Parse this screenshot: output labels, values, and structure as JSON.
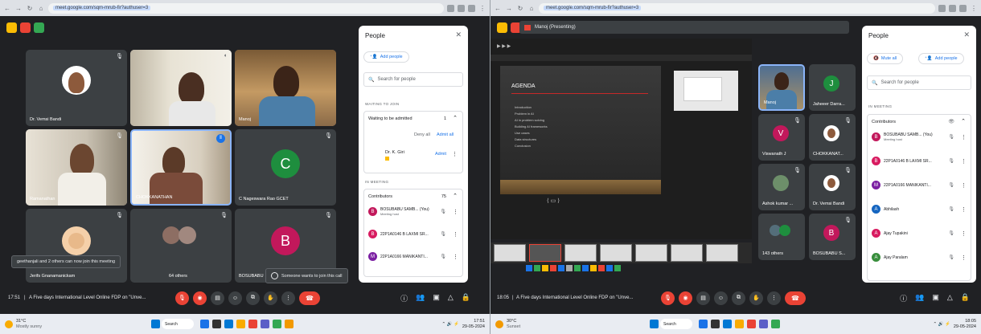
{
  "left": {
    "url": "meet.google.com/sqm-mrub-fir?authuser=3",
    "tiles": [
      {
        "name": "Dr. Vemsi Bandi"
      },
      {
        "name": ""
      },
      {
        "name": "Manoj"
      },
      {
        "name": "Ramanathan"
      },
      {
        "name": "CHOKKANATHAN"
      },
      {
        "name": "C Nageswara Rao GCET",
        "initial": "C"
      },
      {
        "name": "Jerifs Gnanamanickam"
      },
      {
        "name": "64 others"
      },
      {
        "name": "BOSUBABU",
        "initial": "B"
      }
    ],
    "toast_left": "geethanjali and 2 others can now join this meeting",
    "toast_right": "Someone wants to join this call",
    "people": {
      "title": "People",
      "add_people": "Add people",
      "search_placeholder": "Search for people",
      "waiting_header": "WAITING TO JOIN",
      "waiting_label": "Waiting to be admitted",
      "waiting_count": "1",
      "deny_all": "Deny all",
      "admit_all": "Admit all",
      "waiting_person": "Dr. K. Giri",
      "admit": "Admit",
      "in_meeting_header": "IN MEETING",
      "contributors": "Contributors",
      "contributors_count": "75",
      "rows": [
        {
          "initial": "B",
          "name": "BOSUBABU SAMB... (You)",
          "sub": "Meeting host",
          "color": "#c2185b"
        },
        {
          "initial": "B",
          "name": "22P1A0146 B LAXMI SR...",
          "sub": "",
          "color": "#d81b60"
        },
        {
          "initial": "M",
          "name": "22P1A0166 MANIKANTI...",
          "sub": "",
          "color": "#7b1fa2"
        }
      ]
    },
    "time": "17:51",
    "meeting_title": "A Five days International Level Online FDP on \"Unve...",
    "weather_temp": "31°C",
    "weather_desc": "Mostly sunny",
    "search": "Search",
    "clock_time": "17:51",
    "clock_date": "29-05-2024"
  },
  "right": {
    "url": "meet.google.com/sqm-mrub-fir?authuser=3",
    "presenter": "Manoj (Presenting)",
    "slide_title": "AGENDA",
    "slide_lines": [
      "Introduction",
      "Problem in AI",
      "AI in problem solving",
      "Building AI frameworks",
      "Use cases",
      "Data structures",
      "Conclusion"
    ],
    "tiles": [
      {
        "name": "Manoj"
      },
      {
        "name": "Jaheeer Darra...",
        "initial": "J"
      },
      {
        "name": "Viswanath J",
        "initial": "V"
      },
      {
        "name": "CHOKKANAT..."
      },
      {
        "name": "Ashok kumar ..."
      },
      {
        "name": "Dr. Vemsi Bandi"
      },
      {
        "name": "143 others"
      },
      {
        "name": "BOSUBABU S...",
        "initial": "B"
      }
    ],
    "people": {
      "title": "People",
      "mute_all": "Mute all",
      "add_people": "Add people",
      "search_placeholder": "Search for people",
      "in_meeting_header": "IN MEETING",
      "contributors": "Contributors",
      "rows": [
        {
          "initial": "B",
          "name": "BOSUBABU SAMB... (You)",
          "sub": "Meeting host",
          "color": "#c2185b"
        },
        {
          "initial": "B",
          "name": "22P1A0146 B LAXMI SR...",
          "sub": "",
          "color": "#d81b60"
        },
        {
          "initial": "M",
          "name": "22P1A0166 MANIKANTI...",
          "sub": "",
          "color": "#7b1fa2"
        },
        {
          "initial": "A",
          "name": "Abhilash",
          "sub": "",
          "color": "#1565c0"
        },
        {
          "initial": "A",
          "name": "Ajay Tupakini",
          "sub": "",
          "color": "#d81b60"
        },
        {
          "initial": "A",
          "name": "Ajay Paralam",
          "sub": "",
          "color": "#388e3c"
        }
      ]
    },
    "time": "18:05",
    "meeting_title": "A Five days International Level Online FDP on \"Unve...",
    "weather_temp": "30°C",
    "weather_desc": "Sunset",
    "search": "Search",
    "clock_time": "18:05",
    "clock_date": "29-05-2024"
  }
}
